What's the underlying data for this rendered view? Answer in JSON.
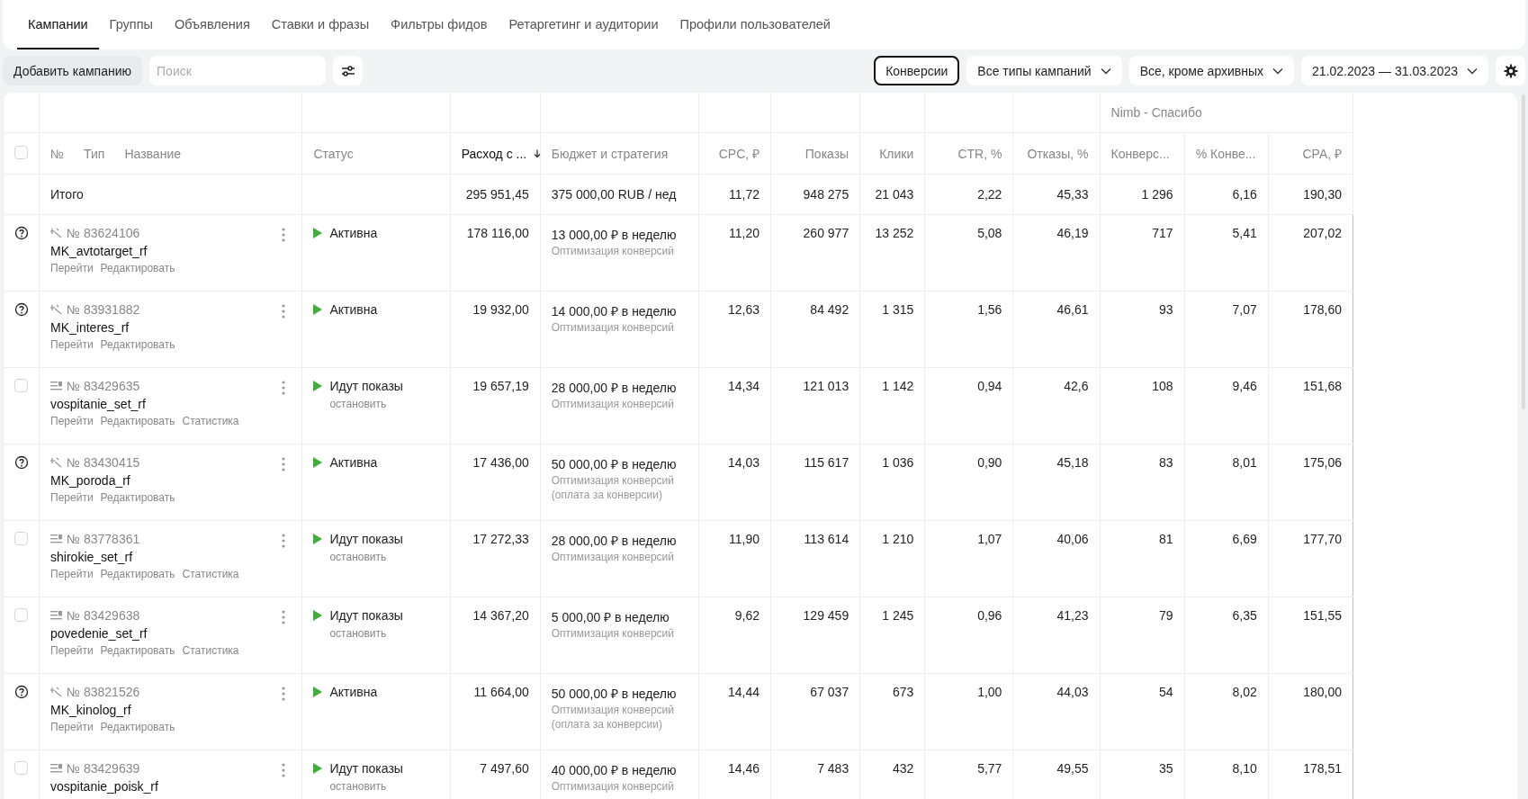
{
  "tabs": [
    {
      "label": "Кампании",
      "selected": true
    },
    {
      "label": "Группы",
      "selected": false
    },
    {
      "label": "Объявления",
      "selected": false
    },
    {
      "label": "Ставки и фразы",
      "selected": false
    },
    {
      "label": "Фильтры фидов",
      "selected": false
    },
    {
      "label": "Ретаргетинг и аудитории",
      "selected": false
    },
    {
      "label": "Профили пользователей",
      "selected": false
    }
  ],
  "toolbar": {
    "add_button": "Добавить кампанию",
    "search": {
      "placeholder": "Поиск"
    },
    "conversions_button": "Конверсии",
    "dropdowns": [
      "Все типы кампаний",
      "Все, кроме архивных",
      "21.02.2023 — 31.03.2023"
    ]
  },
  "table": {
    "group_header": "Nimb - Спасибо",
    "header_checked": false,
    "name_headers": [
      "№",
      "Тип",
      "Название"
    ],
    "columns": [
      {
        "label": "Статус",
        "sorted": false
      },
      {
        "label": "Расход с ...",
        "sorted": true
      },
      {
        "label": "Бюджет и стратегия",
        "sorted": false
      },
      {
        "label": "CPC, ₽",
        "sorted": false
      },
      {
        "label": "Показы",
        "sorted": false
      },
      {
        "label": "Клики",
        "sorted": false
      },
      {
        "label": "CTR, %",
        "sorted": false
      },
      {
        "label": "Отказы, %",
        "sorted": false
      },
      {
        "label": "Конверс...",
        "sorted": false
      },
      {
        "label": "% Конве...",
        "sorted": false
      },
      {
        "label": "CPA, ₽",
        "sorted": false
      }
    ],
    "total": {
      "label": "Итого",
      "spend": "295 951,45",
      "budget": "375 000,00 RUB / нед",
      "cpc": "11,72",
      "shows": "948 275",
      "clicks": "21 043",
      "ctr": "2,22",
      "bounce": "45,33",
      "conv": "1 296",
      "conv_rate": "6,16",
      "cpa": "190,30"
    },
    "rows": [
      {
        "kind": "master",
        "number": "№ 83624106",
        "name": "MK_avtotarget_rf",
        "actions": [
          "Перейти",
          "Редактировать"
        ],
        "status": "Активна",
        "spend": "178 116,00",
        "budget": "13 000,00 ₽ в неделю",
        "strategy": [
          "Оптимизация конверсий"
        ],
        "cpc": "11,20",
        "shows": "260 977",
        "clicks": "13 252",
        "ctr": "5,08",
        "bounce": "46,19",
        "conv": "717",
        "conv_rate": "5,41",
        "cpa": "207,02"
      },
      {
        "kind": "master",
        "number": "№ 83931882",
        "name": "MK_interes_rf",
        "actions": [
          "Перейти",
          "Редактировать"
        ],
        "status": "Активна",
        "spend": "19 932,00",
        "budget": "14 000,00 ₽ в неделю",
        "strategy": [
          "Оптимизация конверсий"
        ],
        "cpc": "12,63",
        "shows": "84 492",
        "clicks": "1 315",
        "ctr": "1,56",
        "bounce": "46,61",
        "conv": "93",
        "conv_rate": "7,07",
        "cpa": "178,60"
      },
      {
        "kind": "text",
        "checked": false,
        "number": "№ 83429635",
        "name": "vospitanie_set_rf",
        "actions": [
          "Перейти",
          "Редактировать",
          "Статистика"
        ],
        "status": "Идут показы",
        "status_action": "остановить",
        "spend": "19 657,19",
        "budget": "28 000,00 ₽ в неделю",
        "strategy": [
          "Оптимизация конверсий"
        ],
        "cpc": "14,34",
        "shows": "121 013",
        "clicks": "1 142",
        "ctr": "0,94",
        "bounce": "42,6",
        "conv": "108",
        "conv_rate": "9,46",
        "cpa": "151,68"
      },
      {
        "kind": "master",
        "number": "№ 83430415",
        "name": "MK_poroda_rf",
        "actions": [
          "Перейти",
          "Редактировать"
        ],
        "status": "Активна",
        "spend": "17 436,00",
        "budget": "50 000,00 ₽ в неделю",
        "strategy": [
          "Оптимизация конверсий",
          "(оплата за конверсии)"
        ],
        "cpc": "14,03",
        "shows": "115 617",
        "clicks": "1 036",
        "ctr": "0,90",
        "bounce": "45,18",
        "conv": "83",
        "conv_rate": "8,01",
        "cpa": "175,06"
      },
      {
        "kind": "text",
        "checked": false,
        "number": "№ 83778361",
        "name": "shirokie_set_rf",
        "actions": [
          "Перейти",
          "Редактировать",
          "Статистика"
        ],
        "status": "Идут показы",
        "status_action": "остановить",
        "spend": "17 272,33",
        "budget": "28 000,00 ₽ в неделю",
        "strategy": [
          "Оптимизация конверсий"
        ],
        "cpc": "11,90",
        "shows": "113 614",
        "clicks": "1 210",
        "ctr": "1,07",
        "bounce": "40,06",
        "conv": "81",
        "conv_rate": "6,69",
        "cpa": "177,70"
      },
      {
        "kind": "text",
        "checked": false,
        "number": "№ 83429638",
        "name": "povedenie_set_rf",
        "actions": [
          "Перейти",
          "Редактировать",
          "Статистика"
        ],
        "status": "Идут показы",
        "status_action": "остановить",
        "spend": "14 367,20",
        "budget": "5 000,00 ₽ в неделю",
        "strategy": [
          "Оптимизация конверсий"
        ],
        "cpc": "9,62",
        "shows": "129 459",
        "clicks": "1 245",
        "ctr": "0,96",
        "bounce": "41,23",
        "conv": "79",
        "conv_rate": "6,35",
        "cpa": "151,55"
      },
      {
        "kind": "master",
        "number": "№ 83821526",
        "name": "MK_kinolog_rf",
        "actions": [
          "Перейти",
          "Редактировать"
        ],
        "status": "Активна",
        "spend": "11 664,00",
        "budget": "50 000,00 ₽ в неделю",
        "strategy": [
          "Оптимизация конверсий",
          "(оплата за конверсии)"
        ],
        "cpc": "14,44",
        "shows": "67 037",
        "clicks": "673",
        "ctr": "1,00",
        "bounce": "44,03",
        "conv": "54",
        "conv_rate": "8,02",
        "cpa": "180,00"
      },
      {
        "kind": "text",
        "checked": false,
        "number": "№ 83429639",
        "name": "vospitanie_poisk_rf",
        "status": "Идут показы",
        "status_action": "остановить",
        "spend": "7 497,60",
        "budget": "40 000,00 ₽ в неделю",
        "strategy": [
          "Оптимизация конверсий"
        ],
        "cpc": "14,46",
        "shows": "7 483",
        "clicks": "432",
        "ctr": "5,77",
        "bounce": "49,55",
        "conv": "35",
        "conv_rate": "8,10",
        "cpa": "178,51"
      }
    ]
  }
}
